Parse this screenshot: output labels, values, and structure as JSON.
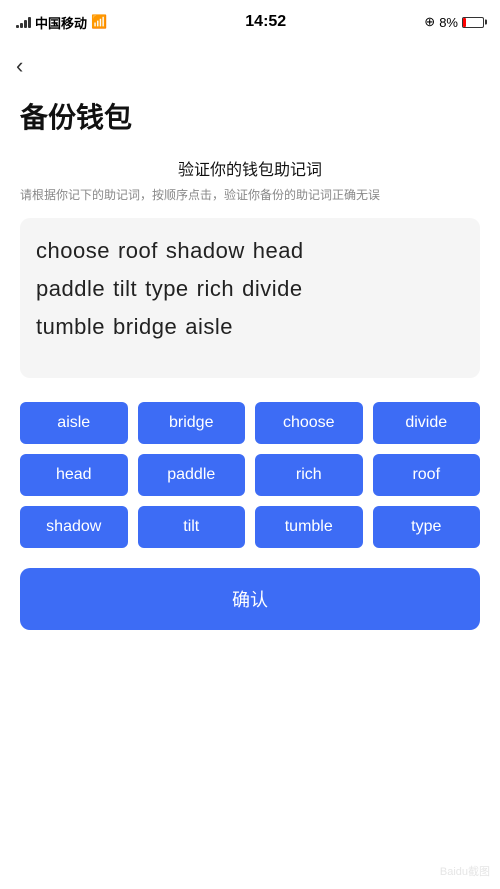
{
  "statusBar": {
    "carrier": "中国移动",
    "time": "14:52",
    "batteryPercent": "8%",
    "batteryLow": true
  },
  "nav": {
    "backIcon": "‹"
  },
  "page": {
    "title": "备份钱包"
  },
  "section": {
    "title": "验证你的钱包助记词",
    "desc": "请根据你记下的助记词，按顺序点击，验证你备份的助记词正确无误"
  },
  "wordRows": [
    [
      "choose",
      "roof",
      "shadow",
      "head"
    ],
    [
      "paddle",
      "tilt",
      "type",
      "rich",
      "divide"
    ],
    [
      "tumble",
      "bridge",
      "aisle"
    ]
  ],
  "wordButtons": [
    "aisle",
    "bridge",
    "choose",
    "divide",
    "head",
    "paddle",
    "rich",
    "roof",
    "shadow",
    "tilt",
    "tumble",
    "type"
  ],
  "confirmButton": {
    "label": "确认"
  }
}
